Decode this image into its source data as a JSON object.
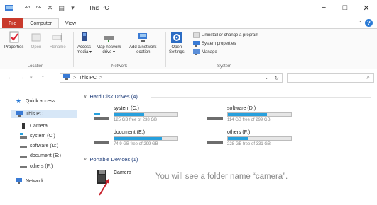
{
  "window": {
    "title": "This PC",
    "controls": {
      "minimize": "−",
      "maximize": "□",
      "close": "✕"
    }
  },
  "tabs": [
    "File",
    "Computer",
    "View"
  ],
  "ribbon": {
    "location": {
      "label": "Location",
      "buttons": [
        {
          "label": "Properties"
        },
        {
          "label": "Open"
        },
        {
          "label": "Rename"
        }
      ]
    },
    "network": {
      "label": "Network",
      "buttons": [
        {
          "label": "Access",
          "sub": "media ▾"
        },
        {
          "label": "Map network",
          "sub": "drive ▾"
        },
        {
          "label": "Add a network",
          "sub": "location"
        }
      ]
    },
    "system": {
      "label": "System",
      "open_settings": {
        "label": "Open",
        "sub": "Settings"
      },
      "items": [
        "Uninstall or change a program",
        "System properties",
        "Manage"
      ]
    }
  },
  "address": {
    "path": "This PC",
    "separator": ">",
    "search_placeholder": ""
  },
  "nav": {
    "items": [
      {
        "label": "Quick access"
      },
      {
        "label": "This PC"
      },
      {
        "label": "Camera"
      },
      {
        "label": "system (C:)"
      },
      {
        "label": "software (D:)"
      },
      {
        "label": "document (E:)"
      },
      {
        "label": "others (F:)"
      },
      {
        "label": "Network"
      }
    ]
  },
  "groups": {
    "hdd": {
      "title": "Hard Disk Drives (4)"
    },
    "portable": {
      "title": "Portable Devices (1)"
    }
  },
  "drives": [
    {
      "name": "system (C:)",
      "free": "125 GB free of 238 GB",
      "used_fraction": 0.47
    },
    {
      "name": "software (D:)",
      "free": "114 GB free of 299 GB",
      "used_fraction": 0.62
    },
    {
      "name": "document (E:)",
      "free": "74.9 GB free of 299 GB",
      "used_fraction": 0.75
    },
    {
      "name": "others (F:)",
      "free": "228 GB free of 331 GB",
      "used_fraction": 0.31
    }
  ],
  "portable_devices": [
    {
      "name": "Camera"
    }
  ],
  "caption": "You will see a folder name “camera”.",
  "colors": {
    "file_tab": "#c8392b",
    "drive_fill": "#27a0dd",
    "selection": "#d7e7f7",
    "annotation_arrow": "#c8202a"
  }
}
